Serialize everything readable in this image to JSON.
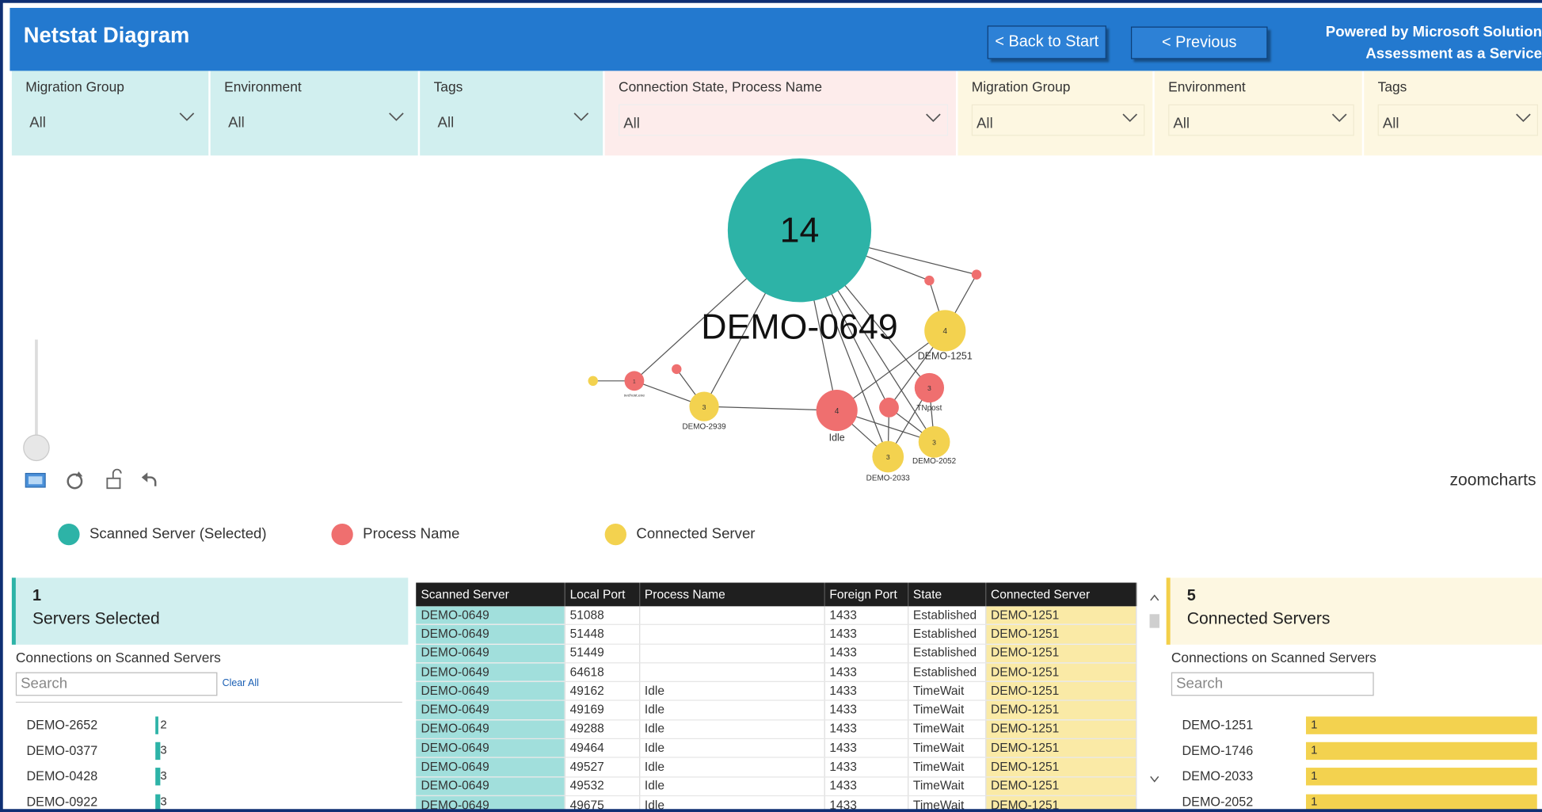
{
  "header": {
    "title": "Netstat Diagram",
    "back_label": "< Back to Start",
    "previous_label": "< Previous",
    "powered_line1": "Powered by Microsoft Solution",
    "powered_line2": "Assessment as a Service"
  },
  "slicers": [
    {
      "label": "Migration Group",
      "value": "All"
    },
    {
      "label": "Environment",
      "value": "All"
    },
    {
      "label": "Tags",
      "value": "All"
    },
    {
      "label": "Connection State, Process Name",
      "value": "All"
    },
    {
      "label": "Migration Group",
      "value": "All"
    },
    {
      "label": "Environment",
      "value": "All"
    },
    {
      "label": "Tags",
      "value": "All"
    }
  ],
  "network": {
    "center_value": "14",
    "center_label": "DEMO-0649",
    "nodes": [
      {
        "label": "DEMO-1251",
        "count": "4"
      },
      {
        "label": "Idle",
        "count": "4"
      },
      {
        "label": "TNpost",
        "count": "3"
      },
      {
        "label": "DEMO-2939",
        "count": "3"
      },
      {
        "label": "DEMO-2052",
        "count": "3"
      },
      {
        "label": "DEMO-2033",
        "count": "3"
      },
      {
        "label": "svchost.exe",
        "count": "1"
      }
    ],
    "watermark": "zoomcharts"
  },
  "colors": {
    "scanned": "#2db3a7",
    "process": "#ef6f6f",
    "connected": "#f3d24f",
    "header": "#2379cf"
  },
  "legend": {
    "scanned": "Scanned Server (Selected)",
    "process": "Process Name",
    "connected": "Connected Server"
  },
  "left_panel": {
    "count": "1",
    "count_label": "Servers Selected",
    "subhead": "Connections on Scanned Servers",
    "search_placeholder": "Search",
    "clear_label": "Clear All",
    "items": [
      {
        "name": "DEMO-2652",
        "value": "2"
      },
      {
        "name": "DEMO-0377",
        "value": "3"
      },
      {
        "name": "DEMO-0428",
        "value": "3"
      },
      {
        "name": "DEMO-0922",
        "value": "3"
      }
    ]
  },
  "right_panel": {
    "count": "5",
    "count_label": "Connected Servers",
    "subhead": "Connections on Scanned Servers",
    "search_placeholder": "Search",
    "items": [
      {
        "name": "DEMO-1251",
        "value": "1"
      },
      {
        "name": "DEMO-1746",
        "value": "1"
      },
      {
        "name": "DEMO-2033",
        "value": "1"
      },
      {
        "name": "DEMO-2052",
        "value": "1"
      }
    ]
  },
  "table": {
    "headers": [
      "Scanned Server",
      "Local Port",
      "Process Name",
      "Foreign Port",
      "State",
      "Connected Server"
    ],
    "rows": [
      [
        "DEMO-0649",
        "51088",
        "",
        "1433",
        "Established",
        "DEMO-1251"
      ],
      [
        "DEMO-0649",
        "51448",
        "",
        "1433",
        "Established",
        "DEMO-1251"
      ],
      [
        "DEMO-0649",
        "51449",
        "",
        "1433",
        "Established",
        "DEMO-1251"
      ],
      [
        "DEMO-0649",
        "64618",
        "",
        "1433",
        "Established",
        "DEMO-1251"
      ],
      [
        "DEMO-0649",
        "49162",
        "Idle",
        "1433",
        "TimeWait",
        "DEMO-1251"
      ],
      [
        "DEMO-0649",
        "49169",
        "Idle",
        "1433",
        "TimeWait",
        "DEMO-1251"
      ],
      [
        "DEMO-0649",
        "49288",
        "Idle",
        "1433",
        "TimeWait",
        "DEMO-1251"
      ],
      [
        "DEMO-0649",
        "49464",
        "Idle",
        "1433",
        "TimeWait",
        "DEMO-1251"
      ],
      [
        "DEMO-0649",
        "49527",
        "Idle",
        "1433",
        "TimeWait",
        "DEMO-1251"
      ],
      [
        "DEMO-0649",
        "49532",
        "Idle",
        "1433",
        "TimeWait",
        "DEMO-1251"
      ],
      [
        "DEMO-0649",
        "49675",
        "Idle",
        "1433",
        "TimeWait",
        "DEMO-1251"
      ]
    ]
  }
}
